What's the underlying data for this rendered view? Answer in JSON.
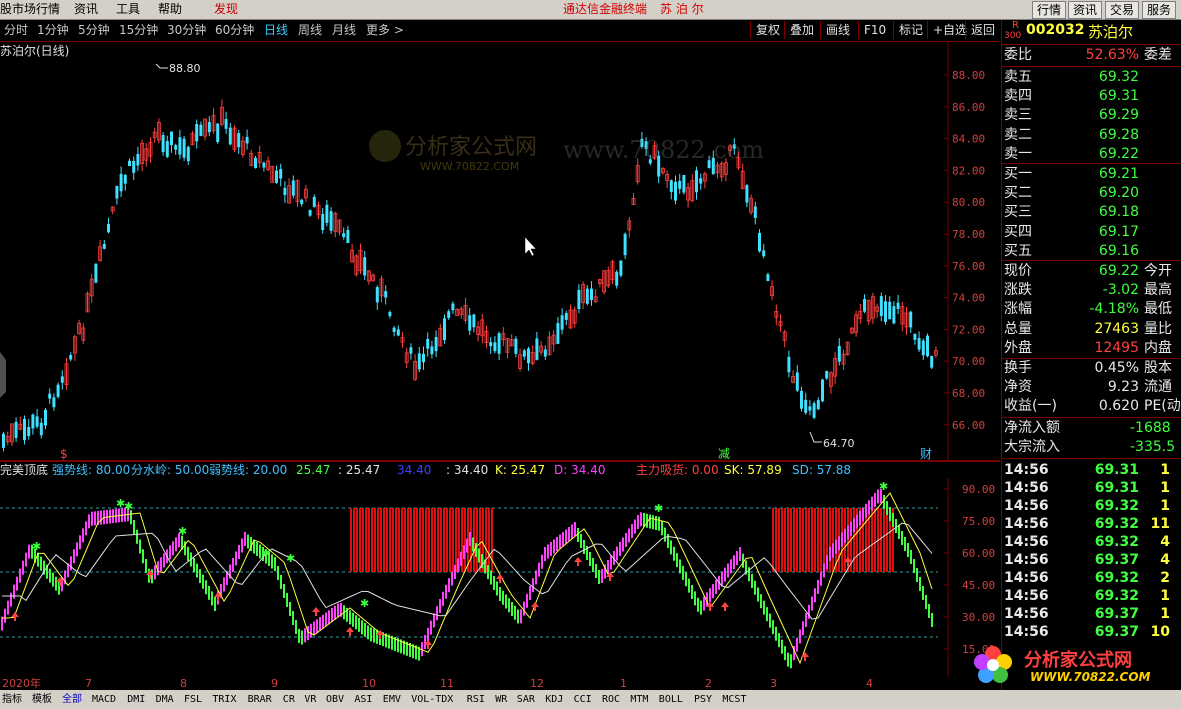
{
  "menubar": {
    "left_title": "股市场行情",
    "items": [
      "资讯",
      "工具",
      "帮助",
      "发现"
    ],
    "center": "通达信金融终端",
    "stock_name": "苏 泊 尔",
    "right_buttons": [
      "行情",
      "资讯",
      "交易",
      "服务"
    ]
  },
  "toolbar": {
    "periods": [
      "分时",
      "1分钟",
      "5分钟",
      "15分钟",
      "30分钟",
      "60分钟",
      "日线",
      "周线",
      "月线",
      "更多 >"
    ],
    "active": "日线",
    "right": [
      "复权",
      "叠加",
      "画线",
      "F10",
      "标记",
      "+自选",
      "返回"
    ]
  },
  "chart": {
    "title": "苏泊尔(日线)",
    "high_label": "88.80",
    "low_label": "64.70",
    "y_ticks": [
      "88.00",
      "86.00",
      "84.00",
      "82.00",
      "80.00",
      "78.00",
      "76.00",
      "74.00",
      "72.00",
      "70.00",
      "68.00",
      "66.00"
    ],
    "markers": [
      "$",
      "减",
      "财"
    ],
    "watermark": "www.70822.com",
    "watermark_logo": "分析家公式网",
    "watermark_sub": "WWW.70822.COM"
  },
  "indicator": {
    "name": "完美顶底",
    "legend": [
      {
        "text": "强势线: 80.00",
        "color": "#40c0ff"
      },
      {
        "text": "分水岭: 50.00",
        "color": "#40c0ff"
      },
      {
        "text": "弱势线: 20.00",
        "color": "#40c0ff"
      },
      {
        "text": "25.47",
        "color": "#40ff40"
      },
      {
        "text": ": 25.47",
        "color": "#e0e0e0"
      },
      {
        "text": "34.40",
        "color": "#4040ff"
      },
      {
        "text": ": 34.40",
        "color": "#e0e0e0"
      },
      {
        "text": "K: 25.47",
        "color": "#ffff40"
      },
      {
        "text": "D: 34.40",
        "color": "#ff40ff"
      },
      {
        "text": "主力吸货: 0.00",
        "color": "#ff4040"
      },
      {
        "text": "SK: 57.89",
        "color": "#ffff40"
      },
      {
        "text": "SD: 57.88",
        "color": "#40c0ff"
      }
    ],
    "y_ticks": [
      "90.00",
      "75.00",
      "60.00",
      "45.00",
      "30.00",
      "15.00"
    ]
  },
  "dates": [
    "2020年",
    "7",
    "8",
    "9",
    "10",
    "11",
    "12",
    "1",
    "2",
    "3",
    "4"
  ],
  "right_panel": {
    "code_prefix": "R",
    "code_sub": "300",
    "code": "002032",
    "name": "苏泊尔",
    "weibi_label": "委比",
    "weibi_value": "52.63%",
    "weicha_label": "委差",
    "sell": [
      {
        "label": "卖五",
        "price": "69.32"
      },
      {
        "label": "卖四",
        "price": "69.31"
      },
      {
        "label": "卖三",
        "price": "69.29"
      },
      {
        "label": "卖二",
        "price": "69.28"
      },
      {
        "label": "卖一",
        "price": "69.22"
      }
    ],
    "buy": [
      {
        "label": "买一",
        "price": "69.21"
      },
      {
        "label": "买二",
        "price": "69.20"
      },
      {
        "label": "买三",
        "price": "69.18"
      },
      {
        "label": "买四",
        "price": "69.17"
      },
      {
        "label": "买五",
        "price": "69.16"
      }
    ],
    "stats": [
      {
        "label": "现价",
        "value": "69.22",
        "color": "green",
        "label2": "今开"
      },
      {
        "label": "涨跌",
        "value": "-3.02",
        "color": "green",
        "label2": "最高"
      },
      {
        "label": "涨幅",
        "value": "-4.18%",
        "color": "green",
        "label2": "最低"
      },
      {
        "label": "总量",
        "value": "27463",
        "color": "yellow",
        "label2": "量比"
      },
      {
        "label": "外盘",
        "value": "12495",
        "color": "red",
        "label2": "内盘"
      }
    ],
    "stats2": [
      {
        "label": "换手",
        "value": "0.45%",
        "label2": "股本"
      },
      {
        "label": "净资",
        "value": "9.23",
        "label2": "流通"
      },
      {
        "label": "收益(一)",
        "value": "0.620",
        "label2": "PE(动)"
      }
    ],
    "flow": [
      {
        "label": "净流入额",
        "value": "-1688"
      },
      {
        "label": "大宗流入",
        "value": "-335.5"
      }
    ],
    "ticks": [
      {
        "time": "14:56",
        "price": "69.31",
        "vol": "1"
      },
      {
        "time": "14:56",
        "price": "69.31",
        "vol": "1"
      },
      {
        "time": "14:56",
        "price": "69.32",
        "vol": "1"
      },
      {
        "time": "14:56",
        "price": "69.32",
        "vol": "11"
      },
      {
        "time": "14:56",
        "price": "69.32",
        "vol": "4"
      },
      {
        "time": "14:56",
        "price": "69.37",
        "vol": "4"
      },
      {
        "time": "14:56",
        "price": "69.32",
        "vol": "2"
      },
      {
        "time": "14:56",
        "price": "69.32",
        "vol": "1"
      },
      {
        "time": "14:56",
        "price": "69.37",
        "vol": "1"
      },
      {
        "time": "14:56",
        "price": "69.37",
        "vol": "10"
      }
    ]
  },
  "bottom_tabs": [
    "指标",
    "模板",
    "全部",
    "MACD",
    "DMI",
    "DMA",
    "FSL",
    "TRIX",
    "BRAR",
    "CR",
    "VR",
    "OBV",
    "ASI",
    "EMV",
    "VOL-TDX",
    "RSI",
    "WR",
    "SAR",
    "KDJ",
    "CCI",
    "ROC",
    "MTM",
    "BOLL",
    "PSY",
    "MCST"
  ],
  "bottom_logo": "分析家公式网",
  "bottom_logo_url": "WWW.70822.COM"
}
